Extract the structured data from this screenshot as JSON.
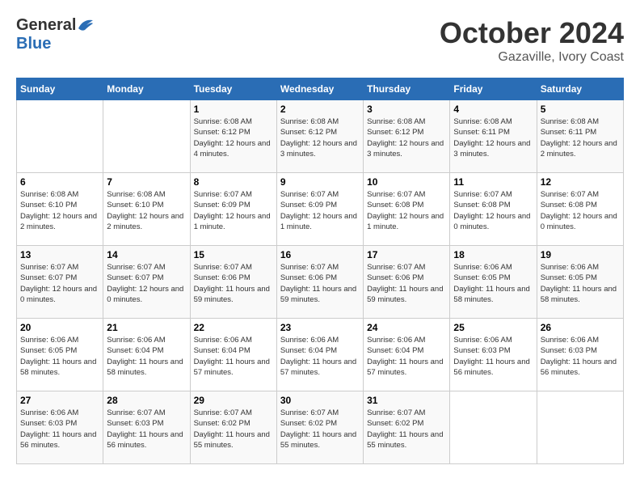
{
  "header": {
    "logo_general": "General",
    "logo_blue": "Blue",
    "month_title": "October 2024",
    "subtitle": "Gazaville, Ivory Coast"
  },
  "days_of_week": [
    "Sunday",
    "Monday",
    "Tuesday",
    "Wednesday",
    "Thursday",
    "Friday",
    "Saturday"
  ],
  "weeks": [
    [
      {
        "day": "",
        "info": ""
      },
      {
        "day": "",
        "info": ""
      },
      {
        "day": "1",
        "info": "Sunrise: 6:08 AM\nSunset: 6:12 PM\nDaylight: 12 hours and 4 minutes."
      },
      {
        "day": "2",
        "info": "Sunrise: 6:08 AM\nSunset: 6:12 PM\nDaylight: 12 hours and 3 minutes."
      },
      {
        "day": "3",
        "info": "Sunrise: 6:08 AM\nSunset: 6:12 PM\nDaylight: 12 hours and 3 minutes."
      },
      {
        "day": "4",
        "info": "Sunrise: 6:08 AM\nSunset: 6:11 PM\nDaylight: 12 hours and 3 minutes."
      },
      {
        "day": "5",
        "info": "Sunrise: 6:08 AM\nSunset: 6:11 PM\nDaylight: 12 hours and 2 minutes."
      }
    ],
    [
      {
        "day": "6",
        "info": "Sunrise: 6:08 AM\nSunset: 6:10 PM\nDaylight: 12 hours and 2 minutes."
      },
      {
        "day": "7",
        "info": "Sunrise: 6:08 AM\nSunset: 6:10 PM\nDaylight: 12 hours and 2 minutes."
      },
      {
        "day": "8",
        "info": "Sunrise: 6:07 AM\nSunset: 6:09 PM\nDaylight: 12 hours and 1 minute."
      },
      {
        "day": "9",
        "info": "Sunrise: 6:07 AM\nSunset: 6:09 PM\nDaylight: 12 hours and 1 minute."
      },
      {
        "day": "10",
        "info": "Sunrise: 6:07 AM\nSunset: 6:08 PM\nDaylight: 12 hours and 1 minute."
      },
      {
        "day": "11",
        "info": "Sunrise: 6:07 AM\nSunset: 6:08 PM\nDaylight: 12 hours and 0 minutes."
      },
      {
        "day": "12",
        "info": "Sunrise: 6:07 AM\nSunset: 6:08 PM\nDaylight: 12 hours and 0 minutes."
      }
    ],
    [
      {
        "day": "13",
        "info": "Sunrise: 6:07 AM\nSunset: 6:07 PM\nDaylight: 12 hours and 0 minutes."
      },
      {
        "day": "14",
        "info": "Sunrise: 6:07 AM\nSunset: 6:07 PM\nDaylight: 12 hours and 0 minutes."
      },
      {
        "day": "15",
        "info": "Sunrise: 6:07 AM\nSunset: 6:06 PM\nDaylight: 11 hours and 59 minutes."
      },
      {
        "day": "16",
        "info": "Sunrise: 6:07 AM\nSunset: 6:06 PM\nDaylight: 11 hours and 59 minutes."
      },
      {
        "day": "17",
        "info": "Sunrise: 6:07 AM\nSunset: 6:06 PM\nDaylight: 11 hours and 59 minutes."
      },
      {
        "day": "18",
        "info": "Sunrise: 6:06 AM\nSunset: 6:05 PM\nDaylight: 11 hours and 58 minutes."
      },
      {
        "day": "19",
        "info": "Sunrise: 6:06 AM\nSunset: 6:05 PM\nDaylight: 11 hours and 58 minutes."
      }
    ],
    [
      {
        "day": "20",
        "info": "Sunrise: 6:06 AM\nSunset: 6:05 PM\nDaylight: 11 hours and 58 minutes."
      },
      {
        "day": "21",
        "info": "Sunrise: 6:06 AM\nSunset: 6:04 PM\nDaylight: 11 hours and 58 minutes."
      },
      {
        "day": "22",
        "info": "Sunrise: 6:06 AM\nSunset: 6:04 PM\nDaylight: 11 hours and 57 minutes."
      },
      {
        "day": "23",
        "info": "Sunrise: 6:06 AM\nSunset: 6:04 PM\nDaylight: 11 hours and 57 minutes."
      },
      {
        "day": "24",
        "info": "Sunrise: 6:06 AM\nSunset: 6:04 PM\nDaylight: 11 hours and 57 minutes."
      },
      {
        "day": "25",
        "info": "Sunrise: 6:06 AM\nSunset: 6:03 PM\nDaylight: 11 hours and 56 minutes."
      },
      {
        "day": "26",
        "info": "Sunrise: 6:06 AM\nSunset: 6:03 PM\nDaylight: 11 hours and 56 minutes."
      }
    ],
    [
      {
        "day": "27",
        "info": "Sunrise: 6:06 AM\nSunset: 6:03 PM\nDaylight: 11 hours and 56 minutes."
      },
      {
        "day": "28",
        "info": "Sunrise: 6:07 AM\nSunset: 6:03 PM\nDaylight: 11 hours and 56 minutes."
      },
      {
        "day": "29",
        "info": "Sunrise: 6:07 AM\nSunset: 6:02 PM\nDaylight: 11 hours and 55 minutes."
      },
      {
        "day": "30",
        "info": "Sunrise: 6:07 AM\nSunset: 6:02 PM\nDaylight: 11 hours and 55 minutes."
      },
      {
        "day": "31",
        "info": "Sunrise: 6:07 AM\nSunset: 6:02 PM\nDaylight: 11 hours and 55 minutes."
      },
      {
        "day": "",
        "info": ""
      },
      {
        "day": "",
        "info": ""
      }
    ]
  ]
}
